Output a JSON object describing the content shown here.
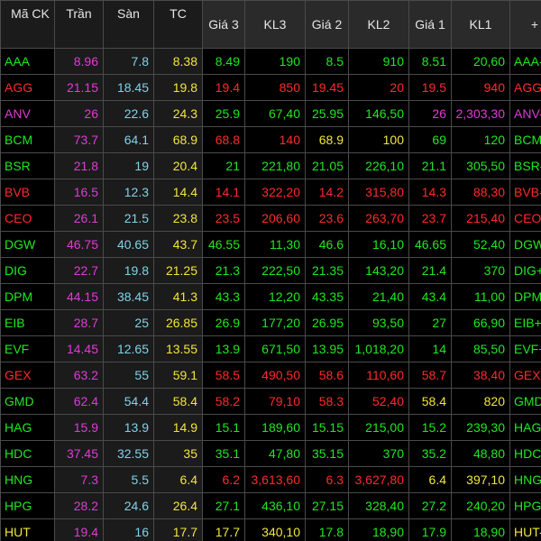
{
  "headers": {
    "symbol": "Mã CK",
    "ceiling": "Trần",
    "floor": "Sàn",
    "reference": "TC",
    "bid3_price": "Giá 3",
    "bid3_vol": "KL3",
    "bid2_price": "Giá 2",
    "bid2_vol": "KL2",
    "bid1_price": "Giá 1",
    "bid1_vol": "KL1",
    "extra": "+"
  },
  "colors": {
    "up": "#22e622",
    "down": "#ff2a2a",
    "ceiling": "#e03bd8",
    "floor": "#7fd3e8",
    "reference": "#f2e63a",
    "header_bg": "#2a2a2a",
    "ref_bg": "#1b1b1b",
    "grid": "#4a4a4a"
  },
  "rows": [
    {
      "symbol": "AAA",
      "ceiling": "8.96",
      "floor": "7.8",
      "ref": "8.38",
      "p3": "8.49",
      "v3": "190",
      "p2": "8.5",
      "v2": "910",
      "p1": "8.51",
      "v1": "20,60",
      "dup": "AAA-",
      "state": "lime",
      "s3": "lime",
      "s2": "lime",
      "s1": "lime"
    },
    {
      "symbol": "AGG",
      "ceiling": "21.15",
      "floor": "18.45",
      "ref": "19.8",
      "p3": "19.4",
      "v3": "850",
      "p2": "19.45",
      "v2": "20",
      "p1": "19.5",
      "v1": "940",
      "dup": "AGG",
      "state": "red",
      "s3": "red",
      "s2": "red",
      "s1": "red"
    },
    {
      "symbol": "ANV",
      "ceiling": "26",
      "floor": "22.6",
      "ref": "24.3",
      "p3": "25.9",
      "v3": "67,40",
      "p2": "25.95",
      "v2": "146,50",
      "p1": "26",
      "v1": "2,303,30",
      "dup": "ANV-",
      "state": "mag",
      "s3": "lime",
      "s2": "lime",
      "s1": "mag"
    },
    {
      "symbol": "BCM",
      "ceiling": "73.7",
      "floor": "64.1",
      "ref": "68.9",
      "p3": "68.8",
      "v3": "140",
      "p2": "68.9",
      "v2": "100",
      "p1": "69",
      "v1": "120",
      "dup": "BCM",
      "state": "lime",
      "s3": "red",
      "s2": "yel",
      "s1": "lime"
    },
    {
      "symbol": "BSR",
      "ceiling": "21.8",
      "floor": "19",
      "ref": "20.4",
      "p3": "21",
      "v3": "221,80",
      "p2": "21.05",
      "v2": "226,10",
      "p1": "21.1",
      "v1": "305,50",
      "dup": "BSR-",
      "state": "lime",
      "s3": "lime",
      "s2": "lime",
      "s1": "lime"
    },
    {
      "symbol": "BVB",
      "ceiling": "16.5",
      "floor": "12.3",
      "ref": "14.4",
      "p3": "14.1",
      "v3": "322,20",
      "p2": "14.2",
      "v2": "315,80",
      "p1": "14.3",
      "v1": "88,30",
      "dup": "BVB-",
      "state": "red",
      "s3": "red",
      "s2": "red",
      "s1": "red"
    },
    {
      "symbol": "CEO",
      "ceiling": "26.1",
      "floor": "21.5",
      "ref": "23.8",
      "p3": "23.5",
      "v3": "206,60",
      "p2": "23.6",
      "v2": "263,70",
      "p1": "23.7",
      "v1": "215,40",
      "dup": "CEO",
      "state": "red",
      "s3": "red",
      "s2": "red",
      "s1": "red"
    },
    {
      "symbol": "DGW",
      "ceiling": "46.75",
      "floor": "40.65",
      "ref": "43.7",
      "p3": "46.55",
      "v3": "11,30",
      "p2": "46.6",
      "v2": "16,10",
      "p1": "46.65",
      "v1": "52,40",
      "dup": "DGW",
      "state": "lime",
      "s3": "lime",
      "s2": "lime",
      "s1": "lime"
    },
    {
      "symbol": "DIG",
      "ceiling": "22.7",
      "floor": "19.8",
      "ref": "21.25",
      "p3": "21.3",
      "v3": "222,50",
      "p2": "21.35",
      "v2": "143,20",
      "p1": "21.4",
      "v1": "370",
      "dup": "DIG+",
      "state": "lime",
      "s3": "lime",
      "s2": "lime",
      "s1": "lime"
    },
    {
      "symbol": "DPM",
      "ceiling": "44.15",
      "floor": "38.45",
      "ref": "41.3",
      "p3": "43.3",
      "v3": "12,20",
      "p2": "43.35",
      "v2": "21,40",
      "p1": "43.4",
      "v1": "11,00",
      "dup": "DPM",
      "state": "lime",
      "s3": "lime",
      "s2": "lime",
      "s1": "lime"
    },
    {
      "symbol": "EIB",
      "ceiling": "28.7",
      "floor": "25",
      "ref": "26.85",
      "p3": "26.9",
      "v3": "177,20",
      "p2": "26.95",
      "v2": "93,50",
      "p1": "27",
      "v1": "66,90",
      "dup": "EIB+",
      "state": "lime",
      "s3": "lime",
      "s2": "lime",
      "s1": "lime"
    },
    {
      "symbol": "EVF",
      "ceiling": "14.45",
      "floor": "12.65",
      "ref": "13.55",
      "p3": "13.9",
      "v3": "671,50",
      "p2": "13.95",
      "v2": "1,018,20",
      "p1": "14",
      "v1": "85,50",
      "dup": "EVF+",
      "state": "lime",
      "s3": "lime",
      "s2": "lime",
      "s1": "lime"
    },
    {
      "symbol": "GEX",
      "ceiling": "63.2",
      "floor": "55",
      "ref": "59.1",
      "p3": "58.5",
      "v3": "490,50",
      "p2": "58.6",
      "v2": "110,60",
      "p1": "58.7",
      "v1": "38,40",
      "dup": "GEX-",
      "state": "red",
      "s3": "red",
      "s2": "red",
      "s1": "red"
    },
    {
      "symbol": "GMD",
      "ceiling": "62.4",
      "floor": "54.4",
      "ref": "58.4",
      "p3": "58.2",
      "v3": "79,10",
      "p2": "58.3",
      "v2": "52,40",
      "p1": "58.4",
      "v1": "820",
      "dup": "GMD",
      "state": "lime",
      "s3": "red",
      "s2": "red",
      "s1": "yel"
    },
    {
      "symbol": "HAG",
      "ceiling": "15.9",
      "floor": "13.9",
      "ref": "14.9",
      "p3": "15.1",
      "v3": "189,60",
      "p2": "15.15",
      "v2": "215,00",
      "p1": "15.2",
      "v1": "239,30",
      "dup": "HAG",
      "state": "lime",
      "s3": "lime",
      "s2": "lime",
      "s1": "lime"
    },
    {
      "symbol": "HDC",
      "ceiling": "37.45",
      "floor": "32.55",
      "ref": "35",
      "p3": "35.1",
      "v3": "47,80",
      "p2": "35.15",
      "v2": "370",
      "p1": "35.2",
      "v1": "48,80",
      "dup": "HDC",
      "state": "lime",
      "s3": "lime",
      "s2": "lime",
      "s1": "lime"
    },
    {
      "symbol": "HNG",
      "ceiling": "7.3",
      "floor": "5.5",
      "ref": "6.4",
      "p3": "6.2",
      "v3": "3,613,60",
      "p2": "6.3",
      "v2": "3,627,80",
      "p1": "6.4",
      "v1": "397,10",
      "dup": "HNG",
      "state": "lime",
      "s3": "red",
      "s2": "red",
      "s1": "yel"
    },
    {
      "symbol": "HPG",
      "ceiling": "28.2",
      "floor": "24.6",
      "ref": "26.4",
      "p3": "27.1",
      "v3": "436,10",
      "p2": "27.15",
      "v2": "328,40",
      "p1": "27.2",
      "v1": "240,20",
      "dup": "HPG",
      "state": "lime",
      "s3": "lime",
      "s2": "lime",
      "s1": "lime"
    },
    {
      "symbol": "HUT",
      "ceiling": "19.4",
      "floor": "16",
      "ref": "17.7",
      "p3": "17.7",
      "v3": "340,10",
      "p2": "17.8",
      "v2": "18,90",
      "p1": "17.9",
      "v1": "18,90",
      "dup": "HUT-",
      "state": "yel",
      "s3": "yel",
      "s2": "lime",
      "s1": "lime"
    }
  ]
}
